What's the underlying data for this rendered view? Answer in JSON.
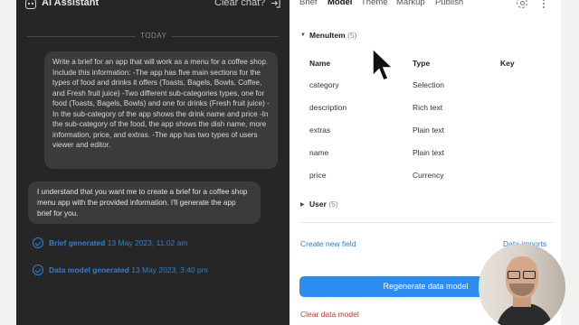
{
  "chat": {
    "title": "AI Assistant",
    "clear_label": "Clear chat?",
    "divider_label": "TODAY",
    "user_message": "Write a brief for an app that will work as a menu for a coffee shop. Include this information: -The app has five main sections for the types of food and drinks it offers (Toasts, Bagels, Bowls, Coffee, and Fresh fruit juice) -Two different sub-categories types, one for food (Toasts, Bagels, Bowls) and one for drinks (Fresh fruit juice) -In the sub-category of the app shows the drink name and price -In the sub-category of the food, the app shows the dish name, more information, price, and extras. -The app has two types of users viewer and editor.",
    "assistant_message": "I understand that you want me to create a brief for a coffee shop menu app with the provided information. I'll generate the app brief for you.",
    "statuses": [
      {
        "label": "Brief generated",
        "date": "13 May 2023, 11:02 am"
      },
      {
        "label": "Data model generated",
        "date": "13 May 2023, 3:40 pm"
      }
    ],
    "icons": {
      "header": "bot-icon",
      "exit": "exit-icon",
      "status": "check-circle-icon"
    }
  },
  "panel": {
    "tabs": [
      "Brief",
      "Model",
      "Theme",
      "Markup",
      "Publish"
    ],
    "active_tab": "Model",
    "groups": [
      {
        "name": "MenuItem",
        "count": "(5)",
        "expanded": true
      },
      {
        "name": "User",
        "count": "(5)",
        "expanded": false
      }
    ],
    "table": {
      "headers": [
        "Name",
        "Type",
        "Key"
      ],
      "rows": [
        {
          "name": "category",
          "type": "Selection",
          "key": ""
        },
        {
          "name": "description",
          "type": "Rich text",
          "key": ""
        },
        {
          "name": "extras",
          "type": "Plain text",
          "key": ""
        },
        {
          "name": "name",
          "type": "Plain text",
          "key": ""
        },
        {
          "name": "price",
          "type": "Currency",
          "key": ""
        }
      ]
    },
    "create_field_label": "Create new field",
    "data_imports_label": "Data imports",
    "regenerate_label": "Regenerate data model",
    "clear_model_label": "Clear data model"
  },
  "colors": {
    "accent": "#2d8cf0",
    "chat_bg": "#262626",
    "danger": "#c0392b"
  }
}
